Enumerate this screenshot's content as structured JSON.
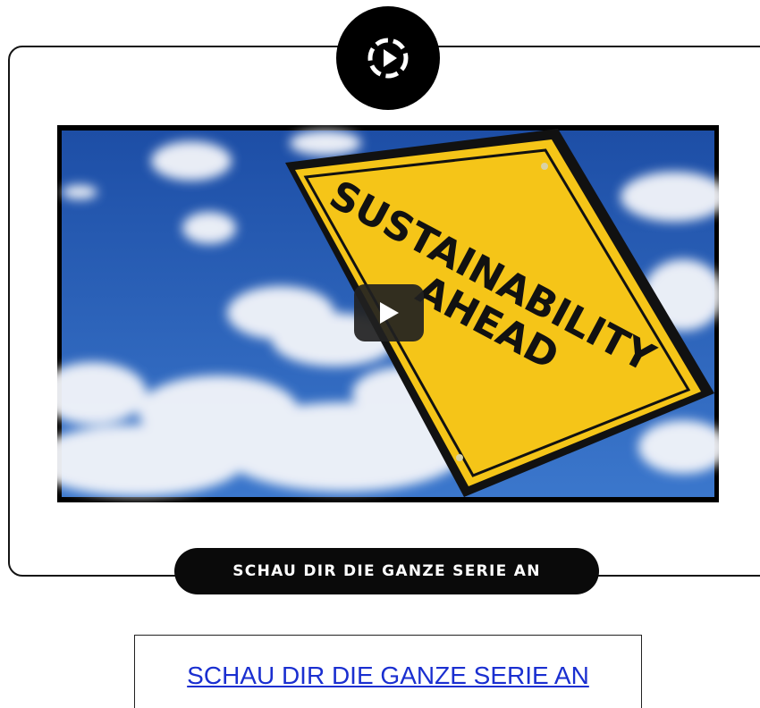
{
  "card": {
    "badge_icon": "play-circle-dashed-icon",
    "video": {
      "thumbnail_sign_text": [
        "SUSTAINABILITY",
        "AHEAD"
      ],
      "play_icon": "play-icon",
      "colors": {
        "sky": "#2a5fb8",
        "sign": "#f5c518",
        "sign_border": "#111111"
      }
    },
    "cta_label": "SCHAU DIR DIE GANZE SERIE AN"
  },
  "link": {
    "label": "SCHAU DIR DIE GANZE SERIE AN",
    "color": "#1a2fd0"
  }
}
